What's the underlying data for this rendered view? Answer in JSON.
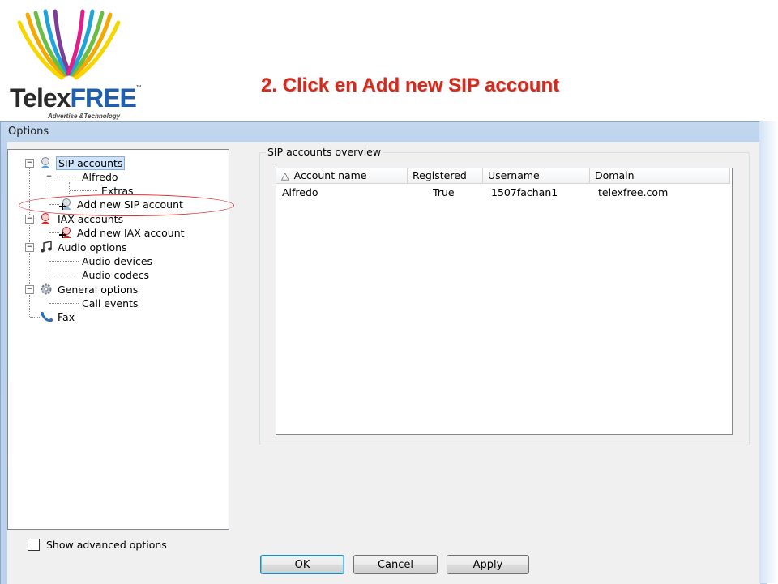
{
  "slide": {
    "logo": {
      "brand_part1": "Telex",
      "brand_part2": "FREE",
      "trademark": "™",
      "tagline": "Advertise &Technology"
    },
    "instruction": "2. Click en  Add new SIP account",
    "colors": {
      "instruction": "#d42a1e",
      "highlight_oval": "#e03030",
      "brand_blue": "#1f5fae"
    }
  },
  "dialog": {
    "title": "Options",
    "tree": {
      "nodes": [
        {
          "label": "SIP accounts",
          "icon": "sip-accounts-icon",
          "selected": true,
          "expanded": true
        },
        {
          "label": "Alfredo",
          "expanded": true
        },
        {
          "label": "Extras"
        },
        {
          "label": "Add new SIP account",
          "icon": "add-account-icon"
        },
        {
          "label": "IAX accounts",
          "icon": "iax-accounts-icon",
          "expanded": true
        },
        {
          "label": "Add new IAX account",
          "icon": "add-account-icon"
        },
        {
          "label": "Audio options",
          "icon": "audio-icon",
          "expanded": true
        },
        {
          "label": "Audio devices"
        },
        {
          "label": "Audio codecs"
        },
        {
          "label": "General options",
          "icon": "gear-icon",
          "expanded": true
        },
        {
          "label": "Call events"
        },
        {
          "label": "Fax",
          "icon": "fax-icon"
        }
      ]
    },
    "overview": {
      "title": "SIP accounts overview",
      "columns": [
        "Account name",
        "Registered",
        "Username",
        "Domain"
      ],
      "sort_indicator": "△",
      "rows": [
        [
          "Alfredo",
          "True",
          "1507fachan1",
          "telexfree.com"
        ]
      ]
    },
    "show_advanced": {
      "label": "Show advanced options",
      "checked": false
    },
    "buttons": {
      "ok": "OK",
      "cancel": "Cancel",
      "apply": "Apply"
    }
  }
}
